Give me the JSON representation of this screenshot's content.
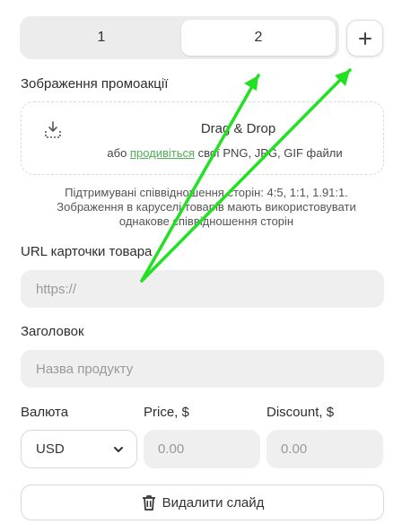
{
  "tabs": [
    {
      "label": "1",
      "active": false
    },
    {
      "label": "2",
      "active": true
    }
  ],
  "add_label": "+",
  "image_section": {
    "label": "Зображення промоакції",
    "drop_title": "Drag & Drop",
    "drop_prefix": "або ",
    "drop_link": "продивіться",
    "drop_suffix": " свої PNG, JPG, GIF файли",
    "hint_line1": "Підтримувані співвідношення сторін: 4:5, 1:1, 1.91:1.",
    "hint_line2": "Зображення в каруселі товарів мають використовувати",
    "hint_line3": "однакове співвідношення сторін"
  },
  "url_field": {
    "label": "URL карточки товара",
    "placeholder": "https://"
  },
  "title_field": {
    "label": "Заголовок",
    "placeholder": "Назва продукту"
  },
  "currency": {
    "label": "Валюта",
    "value": "USD"
  },
  "price": {
    "label": "Price, $",
    "placeholder": "0.00"
  },
  "discount": {
    "label": "Discount, $",
    "placeholder": "0.00"
  },
  "delete_label": "Видалити слайд",
  "colors": {
    "accent": "#4caf50",
    "arrow": "#22e022"
  }
}
